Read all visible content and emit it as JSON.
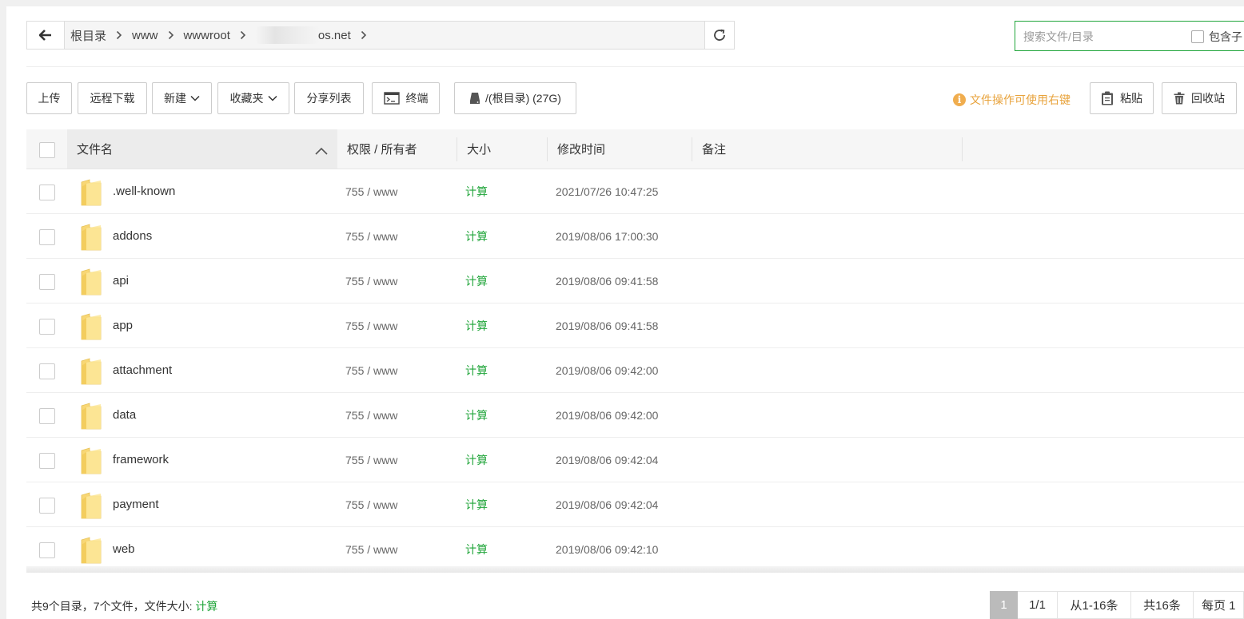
{
  "pathbar": {
    "crumbs": [
      "根目录",
      "www",
      "wwwroot",
      "os.net"
    ]
  },
  "search": {
    "placeholder": "搜索文件/目录",
    "include_sub_label": "包含子"
  },
  "toolbar": {
    "upload": "上传",
    "remote_download": "远程下载",
    "new": "新建",
    "favorites": "收藏夹",
    "share_list": "分享列表",
    "terminal": "终端",
    "disk": "/(根目录) (27G)",
    "tip": "文件操作可使用右键",
    "paste": "粘贴",
    "recycle_bin": "回收站"
  },
  "table": {
    "headers": {
      "name": "文件名",
      "permission": "权限 / 所有者",
      "size": "大小",
      "mtime": "修改时间",
      "remark": "备注"
    },
    "rows": [
      {
        "name": ".well-known",
        "permission": "755 / www",
        "size": "计算",
        "mtime": "2021/07/26 10:47:25"
      },
      {
        "name": "addons",
        "permission": "755 / www",
        "size": "计算",
        "mtime": "2019/08/06 17:00:30"
      },
      {
        "name": "api",
        "permission": "755 / www",
        "size": "计算",
        "mtime": "2019/08/06 09:41:58"
      },
      {
        "name": "app",
        "permission": "755 / www",
        "size": "计算",
        "mtime": "2019/08/06 09:41:58"
      },
      {
        "name": "attachment",
        "permission": "755 / www",
        "size": "计算",
        "mtime": "2019/08/06 09:42:00"
      },
      {
        "name": "data",
        "permission": "755 / www",
        "size": "计算",
        "mtime": "2019/08/06 09:42:00"
      },
      {
        "name": "framework",
        "permission": "755 / www",
        "size": "计算",
        "mtime": "2019/08/06 09:42:04"
      },
      {
        "name": "payment",
        "permission": "755 / www",
        "size": "计算",
        "mtime": "2019/08/06 09:42:04"
      },
      {
        "name": "web",
        "permission": "755 / www",
        "size": "计算",
        "mtime": "2019/08/06 09:42:10"
      }
    ]
  },
  "footer": {
    "summary": "共9个目录，7个文件，文件大小:",
    "calc": "计算",
    "pager": {
      "current": "1",
      "pages": "1/1",
      "range": "从1-16条",
      "total": "共16条",
      "per_page": "每页 1"
    }
  },
  "colors": {
    "accent": "#20a53a",
    "tip": "#e8a33c",
    "folder": "#f8d775"
  }
}
